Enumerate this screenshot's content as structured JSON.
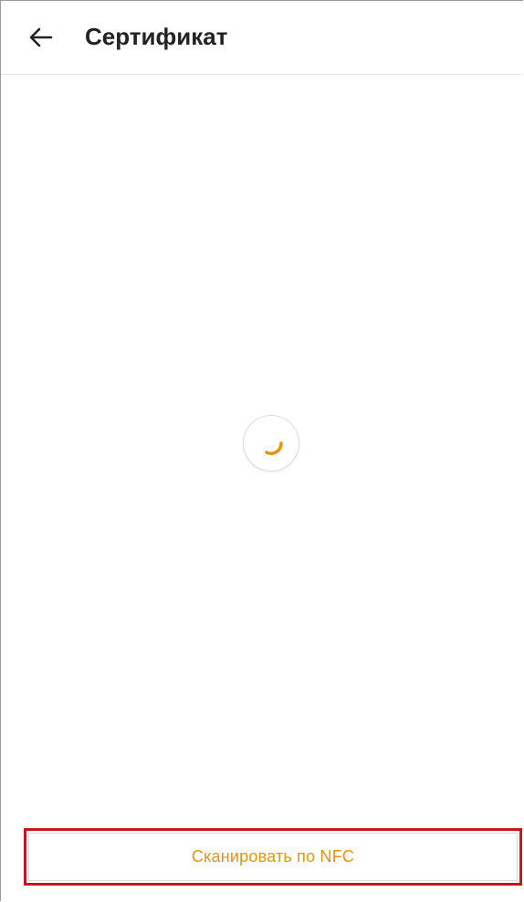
{
  "header": {
    "title": "Сертификат",
    "back_icon": "arrow-left-icon"
  },
  "main": {
    "loading_indicator": "spinner-icon"
  },
  "footer": {
    "nfc_button_label": "Сканировать по NFC"
  },
  "colors": {
    "accent": "#e5940d",
    "highlight_border": "#c8161d",
    "title_text": "#222222"
  }
}
